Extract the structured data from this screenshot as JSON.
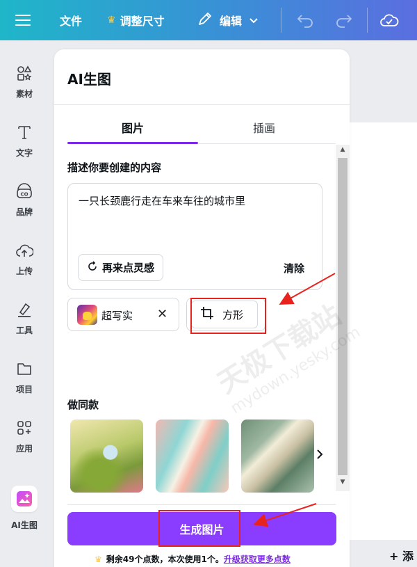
{
  "topbar": {
    "menu_icon": "hamburger-icon",
    "file_label": "文件",
    "resize_label": "调整尺寸",
    "edit_label": "编辑",
    "undo_icon": "undo-icon",
    "redo_icon": "redo-icon",
    "cloud_icon": "cloud-check-icon"
  },
  "rail": {
    "items": [
      {
        "label": "素材",
        "icon": "shapes-icon"
      },
      {
        "label": "文字",
        "icon": "text-icon"
      },
      {
        "label": "品牌",
        "icon": "brand-icon"
      },
      {
        "label": "上传",
        "icon": "upload-cloud-icon"
      },
      {
        "label": "工具",
        "icon": "pen-tool-icon"
      },
      {
        "label": "项目",
        "icon": "folder-icon"
      },
      {
        "label": "应用",
        "icon": "apps-icon"
      },
      {
        "label": "AI生图",
        "icon": "ai-image-icon"
      }
    ]
  },
  "panel": {
    "title": "AI生图",
    "tabs": [
      {
        "label": "图片",
        "active": true
      },
      {
        "label": "插画",
        "active": false
      }
    ],
    "describe_label": "描述你要创建的内容",
    "prompt_text": "一只长颈鹿行走在车来车往的城市里",
    "inspire_label": "再来点灵感",
    "clear_label": "清除",
    "style_label": "超写实",
    "shape_label": "方形",
    "similar_label": "做同款",
    "generate_label": "生成图片",
    "credits_text": "剩余49个点数，本次使用1个。",
    "credits_link": "升级获取更多点数"
  },
  "canvas": {
    "add_page_label": "+ 添"
  },
  "watermark": {
    "main": "天极下载站",
    "sub": "mydown.yesky.com"
  },
  "colors": {
    "accent": "#8b3dff",
    "annotation_red": "#e8231e",
    "topbar_start": "#1fb6c9",
    "topbar_end": "#5b6ee0"
  }
}
